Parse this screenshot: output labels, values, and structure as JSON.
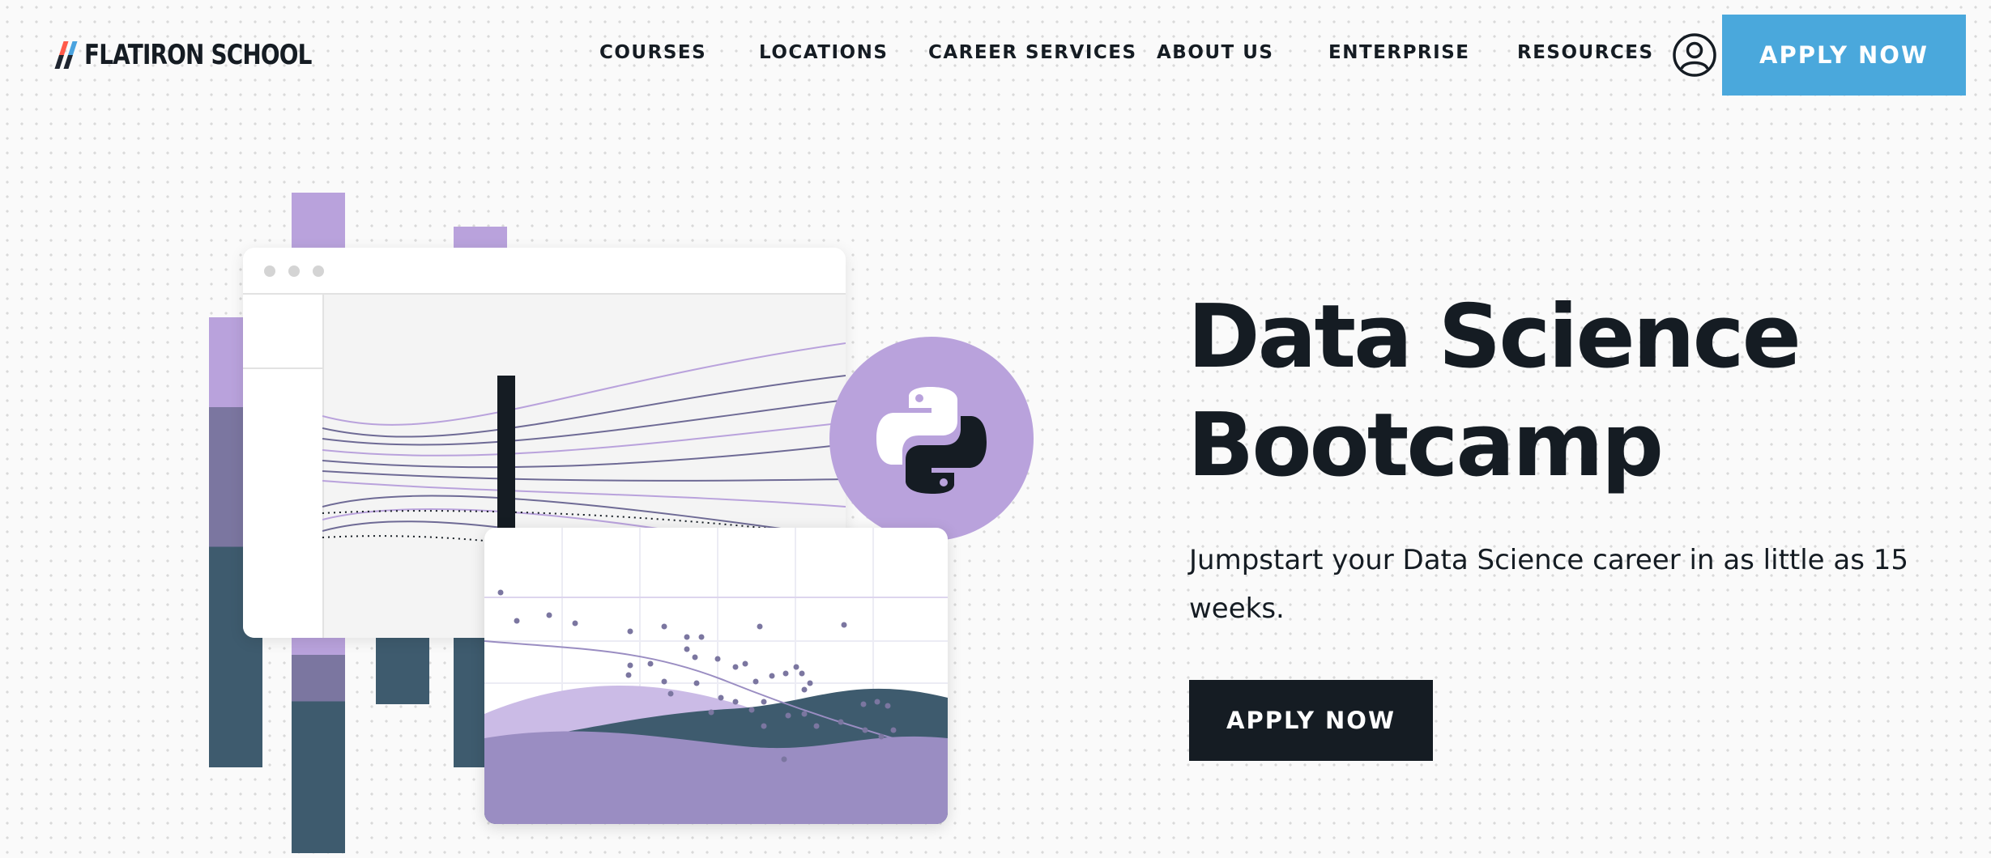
{
  "header": {
    "logo_text": "FLATIRON SCHOOL",
    "nav": [
      "COURSES",
      "LOCATIONS",
      "CAREER SERVICES",
      "ABOUT US",
      "ENTERPRISE",
      "RESOURCES"
    ],
    "user_icon": "user-account-icon",
    "apply_label": "APPLY NOW"
  },
  "hero": {
    "title_line1": "Data Science",
    "title_line2": "Bootcamp",
    "subtitle": "Jumpstart your Data Science career in as little as 15 weeks.",
    "cta_label": "APPLY NOW"
  },
  "illustration": {
    "badge_icon": "python-logo-icon"
  },
  "colors": {
    "accent_blue": "#4aa8dc",
    "dark": "#151c23",
    "purple": "#b9a2dc",
    "slate": "#3e5b6e",
    "background": "#fafafa"
  }
}
